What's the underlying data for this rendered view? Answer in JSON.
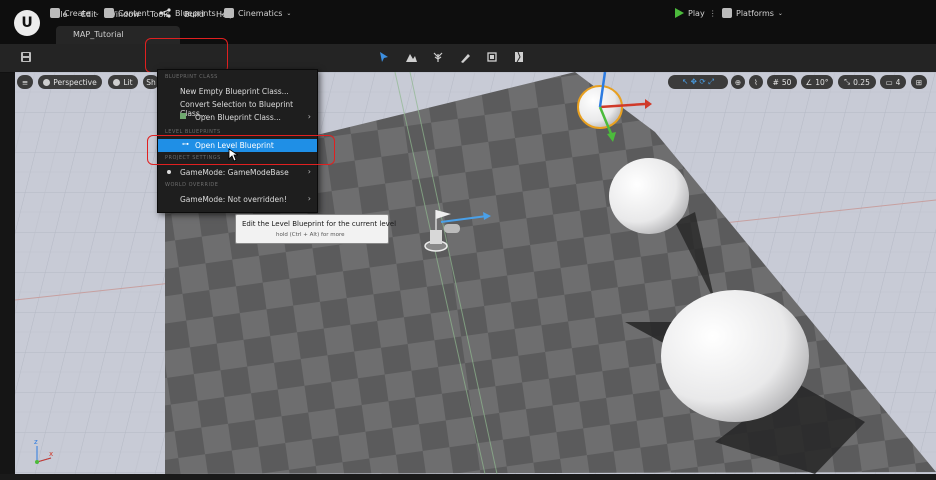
{
  "menubar": {
    "items": [
      "File",
      "Edit",
      "Window",
      "Tools",
      "Build",
      "Help"
    ],
    "logo": "U"
  },
  "level_tab": "MAP_Tutorial",
  "toolbar": {
    "create": "Create",
    "content": "Content",
    "blueprints": "Blueprints",
    "cinematics": "Cinematics",
    "play": "Play",
    "platforms": "Platforms"
  },
  "viewport": {
    "perspective": "Perspective",
    "lit": "Lit",
    "show": "Sh",
    "grid_snap": "50",
    "rotation_snap": "10°",
    "scale_snap": "0.25",
    "camera_speed": "4"
  },
  "blueprint_menu": {
    "sections": {
      "blueprint_class": "BLUEPRINT CLASS",
      "level_blueprints": "LEVEL BLUEPRINTS",
      "project_settings": "PROJECT SETTINGS",
      "world_override": "WORLD OVERRIDE"
    },
    "items": {
      "new_empty": "New Empty Blueprint Class...",
      "convert_selection": "Convert Selection to Blueprint Class...",
      "open_class": "Open Blueprint Class...",
      "open_level": "Open Level Blueprint",
      "gamemode": "GameMode: GameModeBase",
      "gamemode_override": "GameMode: Not overridden!"
    }
  },
  "tooltip": {
    "text": "Edit the Level Blueprint for the current level",
    "hint": "hold (Ctrl + Alt) for more"
  },
  "colors": {
    "highlight_red": "#e02020",
    "menu_selected": "#1f8fe6",
    "play_green": "#4cbb3c"
  }
}
